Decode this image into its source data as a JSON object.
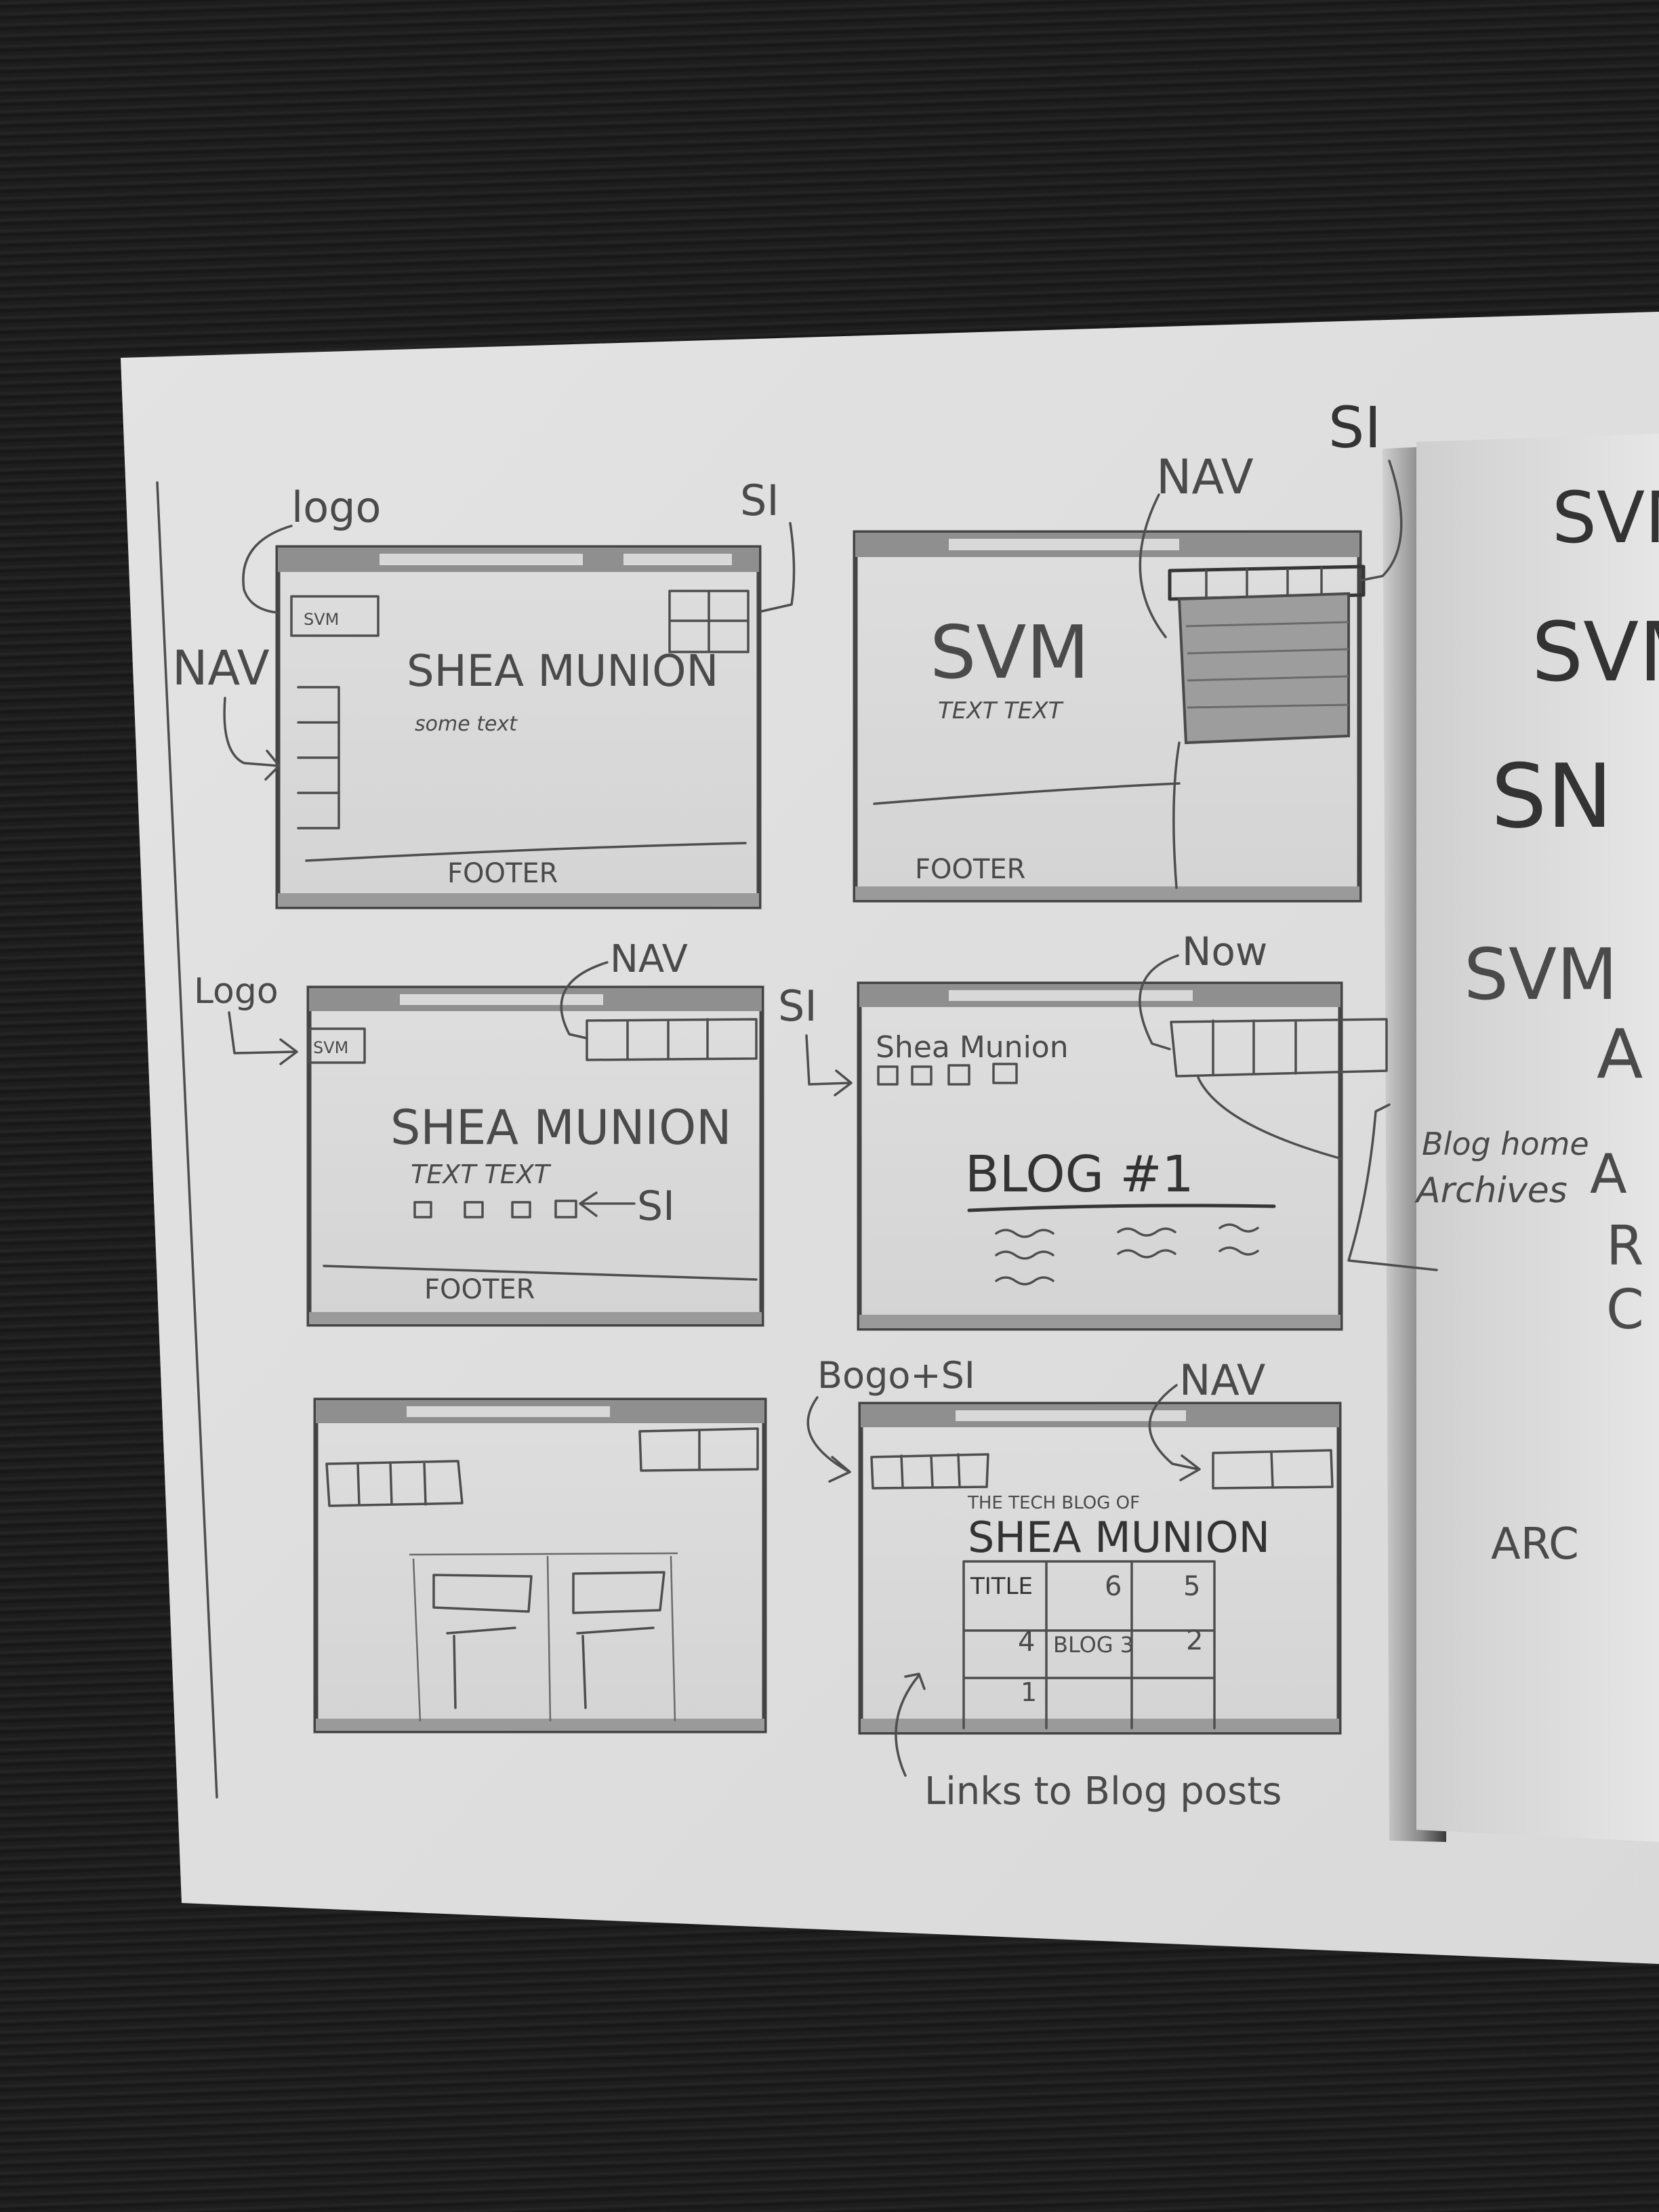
{
  "annotations": {
    "logo": "logo",
    "si": "SI",
    "nav": "NAV",
    "logo_cap": "Logo",
    "now": "Now",
    "blog_home": "Blog home",
    "archives": "Archives",
    "logo_si": "Bogo+SI",
    "links": "Links to Blog posts"
  },
  "frames": {
    "f1": {
      "logo": "SVM",
      "title": "SHEA MUNION",
      "sub": "some text",
      "footer": "FOOTER"
    },
    "f2": {
      "logo": "SVM",
      "sub": "TEXT TEXT",
      "footer": "FOOTER"
    },
    "f3": {
      "logo": "SVM",
      "title": "SHEA MUNION",
      "sub": "TEXT TEXT",
      "footer": "FOOTER"
    },
    "f4": {
      "brand": "Shea Munion",
      "title": "BLOG #1"
    },
    "f6": {
      "tag": "THE TECH BLOG OF",
      "title": "SHEA MUNION",
      "cells": [
        "TITLE",
        "6",
        "5",
        "4",
        "BLOG 3",
        "2",
        "1"
      ]
    }
  },
  "right_page": [
    "SVM",
    "SVM",
    "SN",
    "SVM",
    "A",
    "A",
    "R",
    "C",
    "ARC"
  ]
}
